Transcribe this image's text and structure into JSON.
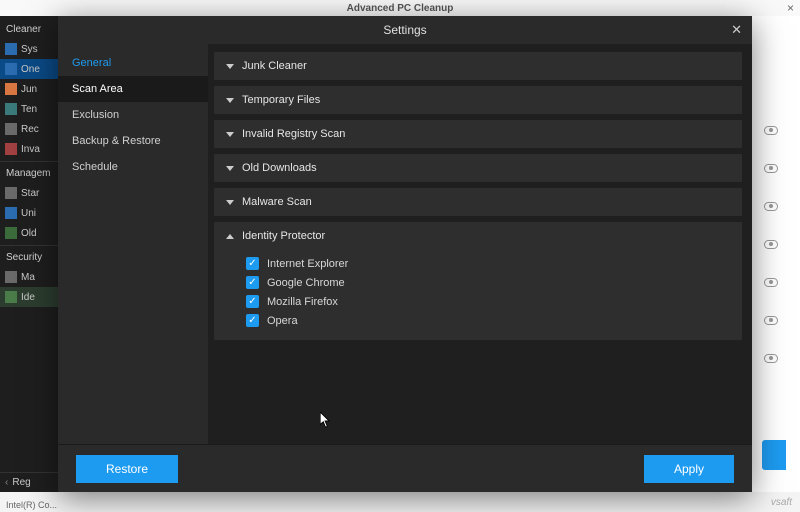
{
  "app": {
    "title": "Advanced PC Cleanup",
    "status": "Intel(R) Co...",
    "watermark": "vsaft"
  },
  "rail": {
    "header1": "Cleaner",
    "items1": [
      "Sys",
      "One",
      "Jun",
      "Ten",
      "Rec",
      "Inva"
    ],
    "header2": "Managem",
    "items2": [
      "Star",
      "Uni",
      "Old"
    ],
    "header3": "Security",
    "items3": [
      "Ma",
      "Ide"
    ],
    "footer": "Reg"
  },
  "modal": {
    "title": "Settings",
    "sidebar": {
      "items": [
        "General",
        "Scan Area",
        "Exclusion",
        "Backup & Restore",
        "Schedule"
      ]
    },
    "sections": [
      {
        "label": "Junk Cleaner"
      },
      {
        "label": "Temporary Files"
      },
      {
        "label": "Invalid Registry Scan"
      },
      {
        "label": "Old Downloads"
      },
      {
        "label": "Malware Scan"
      },
      {
        "label": "Identity Protector"
      }
    ],
    "identity_items": [
      "Internet Explorer",
      "Google Chrome",
      "Mozilla Firefox",
      "Opera"
    ],
    "footer": {
      "restore": "Restore",
      "apply": "Apply"
    }
  }
}
